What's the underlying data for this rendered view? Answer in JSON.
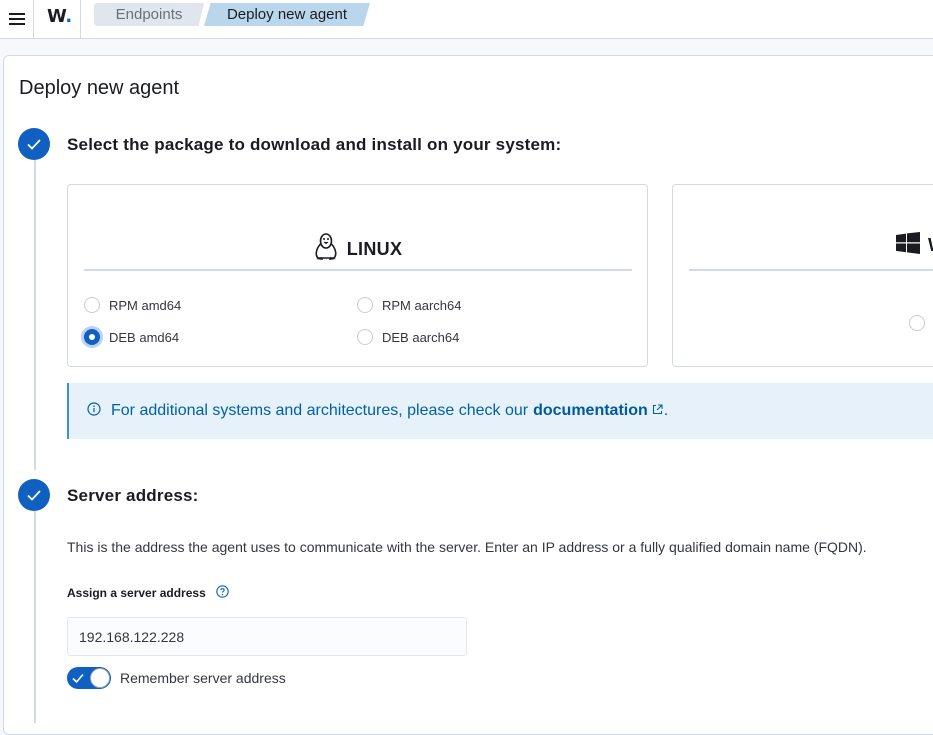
{
  "header": {
    "logo_text": "W",
    "logo_dot": ".",
    "breadcrumbs": [
      {
        "label": "Endpoints"
      },
      {
        "label": "Deploy new agent"
      }
    ]
  },
  "page": {
    "title": "Deploy new agent"
  },
  "steps": [
    {
      "title": "Select the package to download and install on your system:",
      "packages": {
        "linux": {
          "label": "LINUX",
          "options": [
            {
              "label": "RPM amd64",
              "checked": false
            },
            {
              "label": "RPM aarch64",
              "checked": false
            },
            {
              "label": "DEB amd64",
              "checked": true
            },
            {
              "label": "DEB aarch64",
              "checked": false
            }
          ]
        },
        "windows": {
          "label": "W"
        }
      },
      "callout": {
        "text": "For additional systems and architectures, please check our",
        "link": "documentation",
        "suffix": "."
      }
    },
    {
      "title": "Server address:",
      "description": "This is the address the agent uses to communicate with the server. Enter an IP address or a fully qualified domain name (FQDN).",
      "field_label": "Assign a server address",
      "field_value": "192.168.122.228",
      "toggle_label": "Remember server address",
      "toggle_on": true
    }
  ],
  "colors": {
    "primary": "#1060c2",
    "callout_bg": "#e6f1fa"
  }
}
